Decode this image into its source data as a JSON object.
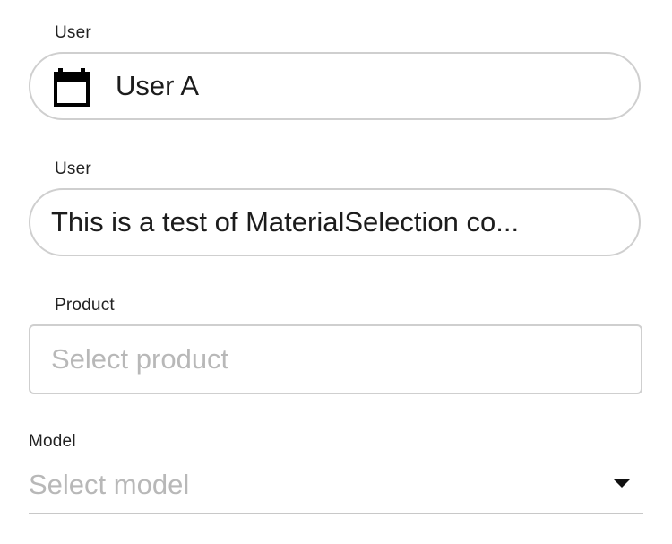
{
  "fields": {
    "user_a": {
      "label": "User",
      "value": "User A",
      "icon": "calendar-icon"
    },
    "user_b": {
      "label": "User",
      "value": "This is a test of MaterialSelection co..."
    },
    "product": {
      "label": "Product",
      "placeholder": "Select product"
    },
    "model": {
      "label": "Model",
      "placeholder": "Select model",
      "icon": "chevron-down-icon"
    }
  }
}
